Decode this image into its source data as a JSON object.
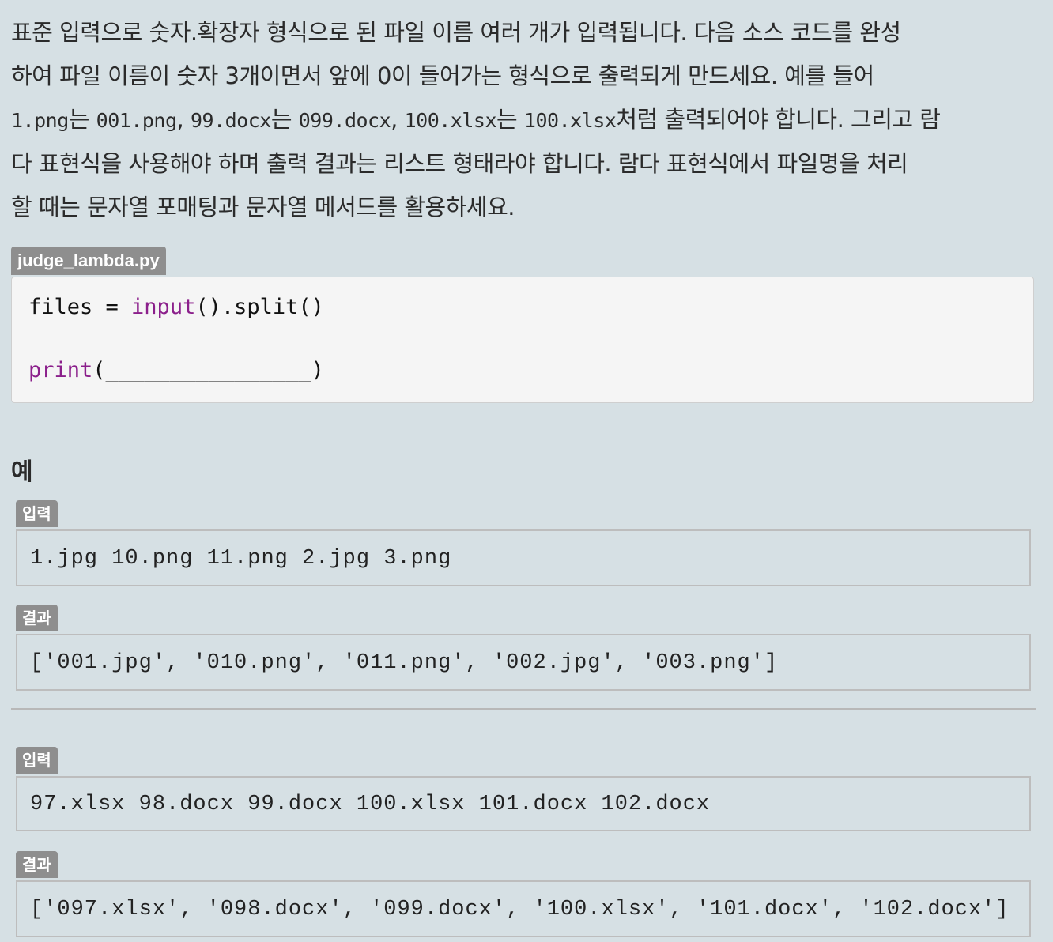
{
  "problem": {
    "line1": "표준 입력으로 숫자.확장자 형식으로 된 파일 이름 여러 개가 입력됩니다. 다음 소스 코드를 완성",
    "line2": "하여 파일 이름이 숫자 3개이면서 앞에 0이 들어가는 형식으로 출력되게 만드세요. 예를 들어",
    "line3_ex1_in": "1.png",
    "line3_word1": "는 ",
    "line3_ex1_out": "001.png",
    "line3_sep1": ", ",
    "line3_ex2_in": "99.docx",
    "line3_word2": "는 ",
    "line3_ex2_out": "099.docx",
    "line3_sep2": ", ",
    "line3_ex3_in": "100.xlsx",
    "line3_word3": "는 ",
    "line3_ex3_out": "100.xlsx",
    "line3_tail": "처럼 출력되어야 합니다. 그리고 람",
    "line4": "다 표현식을 사용해야 하며 출력 결과는 리스트 형태라야 합니다. 람다 표현식에서 파일명을 처리",
    "line5": "할 때는 문자열 포매팅과 문자열 메서드를 활용하세요."
  },
  "code": {
    "filename": "judge_lambda.py",
    "line1_var": "files = ",
    "line1_fn": "input",
    "line1_rest": "().split()",
    "line2_fn": "print",
    "line2_rest": "(________________)"
  },
  "examples_heading": "예",
  "examples": [
    {
      "input_label": "입력",
      "input": "1.jpg 10.png 11.png 2.jpg 3.png",
      "output_label": "결과",
      "output": "['001.jpg', '010.png', '011.png', '002.jpg', '003.png']"
    },
    {
      "input_label": "입력",
      "input": "97.xlsx 98.docx 99.docx 100.xlsx 101.docx 102.docx",
      "output_label": "결과",
      "output": "['097.xlsx', '098.docx', '099.docx', '100.xlsx', '101.docx', '102.docx']"
    }
  ]
}
